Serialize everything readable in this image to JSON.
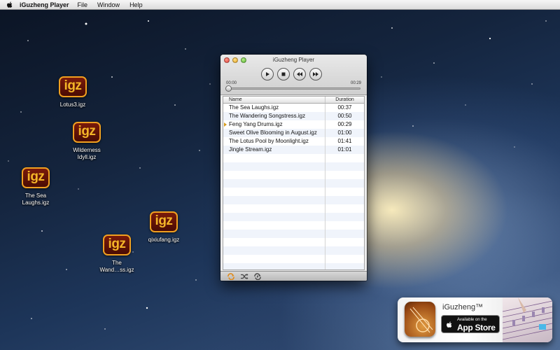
{
  "menubar": {
    "app_name": "iGuzheng Player",
    "items": [
      "File",
      "Window",
      "Help"
    ]
  },
  "desktop_icons": [
    {
      "tile": "igz",
      "label": "Lotus3.igz"
    },
    {
      "tile": "igz",
      "label": "Wilderness\nIdyll.igz"
    },
    {
      "tile": "igz",
      "label": "The Sea\nLaughs.igz"
    },
    {
      "tile": "igz",
      "label": "qixiufang.igz"
    },
    {
      "tile": "igz",
      "label": "The\nWand…ss.igz"
    }
  ],
  "player": {
    "title": "iGuzheng Player",
    "time_elapsed": "00:00",
    "time_total": "00:29",
    "progress_fraction": 0.0,
    "columns": {
      "name": "Name",
      "duration": "Duration"
    },
    "tracks": [
      {
        "name": "The Sea Laughs.igz",
        "duration": "00:37",
        "playing": false
      },
      {
        "name": "The Wandering Songstress.igz",
        "duration": "00:50",
        "playing": false
      },
      {
        "name": "Feng Yang Drums.igz",
        "duration": "00:29",
        "playing": true
      },
      {
        "name": "Sweet Olive Blooming in August.igz",
        "duration": "01:00",
        "playing": false
      },
      {
        "name": "The Lotus Pool by Moonlight.igz",
        "duration": "01:41",
        "playing": false
      },
      {
        "name": "Jingle Stream.igz",
        "duration": "01:01",
        "playing": false
      }
    ],
    "empty_rows": 14,
    "controls": [
      "play-icon",
      "stop-icon",
      "rewind-icon",
      "fast-forward-icon"
    ],
    "bottom_icons": [
      "repeat-icon",
      "shuffle-icon",
      "repeat-one-icon"
    ],
    "accent": "#d59a1a"
  },
  "banner": {
    "app_name": "iGuzheng™",
    "store_line1": "Available on the",
    "store_line2": "App Store"
  }
}
